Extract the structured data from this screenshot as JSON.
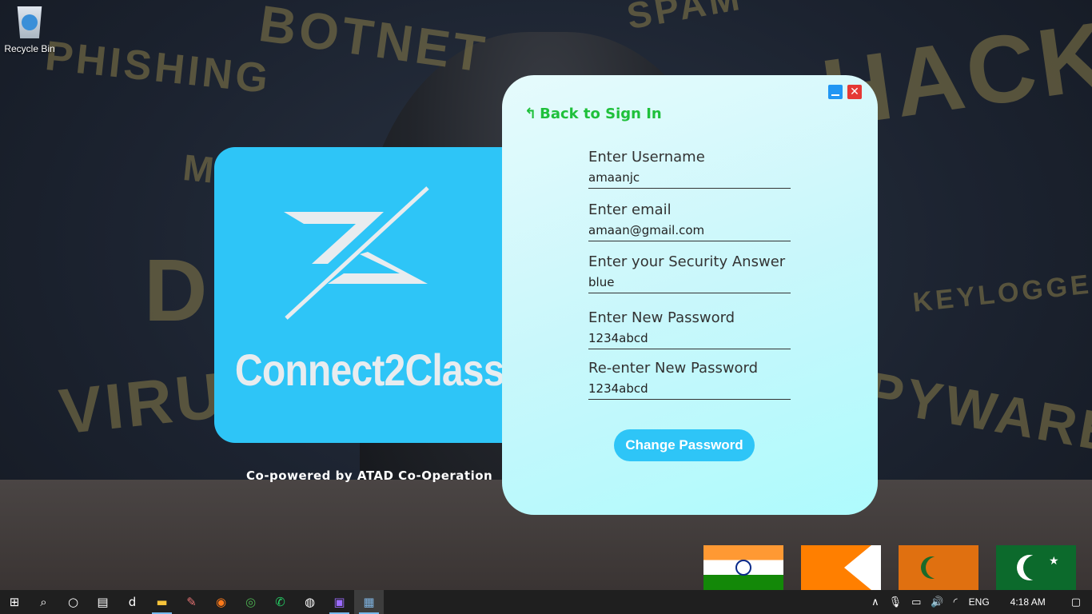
{
  "wallpaper": {
    "words": [
      "PHISHING",
      "BOTNET",
      "SPAM",
      "HACKER",
      "M",
      "DE",
      "VIRUS",
      "KEYLOGGER",
      "PYWARE"
    ]
  },
  "desktop": {
    "icons": [
      {
        "label": "Recycle Bin",
        "icon": "recycle-bin-icon"
      }
    ]
  },
  "brand": {
    "name": "Connect2Class",
    "copowered": "Co-powered by ATAD Co-Operation",
    "color": "#2ec5f7"
  },
  "form": {
    "back_label": "Back to Sign In",
    "fields": [
      {
        "label": "Enter Username",
        "value": "amaanjc"
      },
      {
        "label": "Enter email",
        "value": "amaan@gmail.com"
      },
      {
        "label": "Enter your Security Answer",
        "value": "blue"
      },
      {
        "label": "Enter New Password",
        "value": "1234abcd"
      },
      {
        "label": "Re-enter New Password",
        "value": "1234abcd"
      }
    ],
    "submit_label": "Change Password",
    "minimize_icon": "minimize-icon",
    "close_icon": "close-icon",
    "close_glyph": "✕",
    "accent": "#1fc03b"
  },
  "flags": [
    "india-flag",
    "orange-flag",
    "orange-crescent-flag",
    "pakistan-flag"
  ],
  "taskbar": {
    "items": [
      {
        "name": "start-icon",
        "glyph": "⊞"
      },
      {
        "name": "search-icon",
        "glyph": "⌕"
      },
      {
        "name": "cortana-icon",
        "glyph": "○"
      },
      {
        "name": "task-view-icon",
        "glyph": "▤"
      },
      {
        "name": "dashlane-icon",
        "glyph": "d"
      },
      {
        "name": "file-explorer-icon",
        "glyph": "▬"
      },
      {
        "name": "paint-icon",
        "glyph": "✎"
      },
      {
        "name": "firefox-icon",
        "glyph": "◉"
      },
      {
        "name": "chrome-icon",
        "glyph": "◎"
      },
      {
        "name": "whatsapp-icon",
        "glyph": "✆"
      },
      {
        "name": "obs-icon",
        "glyph": "◍"
      },
      {
        "name": "media-app-icon",
        "glyph": "▣"
      },
      {
        "name": "java-app-icon",
        "glyph": "▦"
      }
    ],
    "tray": {
      "chevron": "∧",
      "mic": "🎙",
      "battery": "▭",
      "volume": "🔊",
      "wifi": "◜",
      "language": "ENG",
      "time": "4:18 AM",
      "notification": "▢"
    }
  }
}
